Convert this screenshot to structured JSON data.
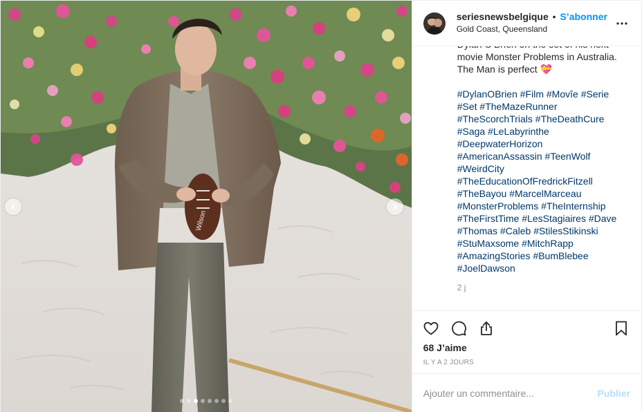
{
  "header": {
    "username": "seriesnewsbelgique",
    "bullet": "•",
    "follow_label": "S’abonner",
    "location": "Gold Coast, Queensland",
    "more_icon": "more-horizontal-icon"
  },
  "caption": {
    "text": "Dylan O'Brien on the set of his next movie Monster Problems in Australia. The Man is perfect 💝",
    "hashtags": [
      "#DylanOBrien #Film #Movîe #Serie",
      "#Set #TheMazeRunner",
      "#TheScorchTrials #TheDeathCure",
      "#Saga #LeLabyrinthe",
      "#DeepwaterHorizon",
      "#AmericanAssassin #TeenWolf",
      "#WeirdCity",
      "#TheEducationOfFredrickFitzell",
      "#TheBayou #MarcelMarceau",
      "#MonsterProblems #TheInternship",
      "#TheFirstTime #LesStagiaires #Dave",
      "#Thomas #Caleb #StilesStikinski",
      "#StuMaxsome #MitchRapp",
      "#AmazingStories #BumBlebee",
      "#JoelDawson"
    ],
    "time_ago": "2 j"
  },
  "actions": {
    "like_icon": "heart-icon",
    "comment_icon": "comment-icon",
    "share_icon": "share-icon",
    "save_icon": "bookmark-icon",
    "likes_text": "68 J’aime",
    "date_text": "Il y a 2 jours"
  },
  "comment_box": {
    "placeholder": "Ajouter un commentaire...",
    "publish_label": "Publier"
  },
  "carousel": {
    "slide_count": 8,
    "active_index": 2,
    "prev_icon": "chevron-left-icon",
    "next_icon": "chevron-right-icon"
  },
  "colors": {
    "accent_blue": "#0095f6",
    "link_blue": "#00376b",
    "muted": "#8e8e8e",
    "publish_disabled": "#b2dffc"
  }
}
